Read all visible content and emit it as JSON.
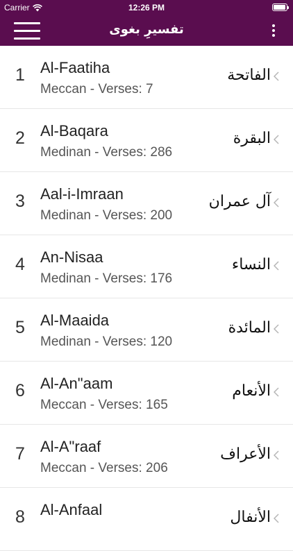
{
  "status_bar": {
    "carrier": "Carrier",
    "time": "12:26 PM",
    "battery_level": 0.95
  },
  "nav": {
    "title": "تفسیرِ بغوی",
    "menu_icon": "hamburger-menu-icon",
    "more_icon": "more-vertical-icon"
  },
  "colors": {
    "brand": "#5a0d4f",
    "divider": "#e6e6e6"
  },
  "surahs": [
    {
      "number": "1",
      "name": "Al-Faatiha",
      "subtitle": "Meccan - Verses: 7",
      "arabic": "الفاتحة"
    },
    {
      "number": "2",
      "name": "Al-Baqara",
      "subtitle": "Medinan - Verses: 286",
      "arabic": "البقرة"
    },
    {
      "number": "3",
      "name": "Aal-i-Imraan",
      "subtitle": "Medinan - Verses: 200",
      "arabic": "آل عمران"
    },
    {
      "number": "4",
      "name": "An-Nisaa",
      "subtitle": "Medinan - Verses: 176",
      "arabic": "النساء"
    },
    {
      "number": "5",
      "name": "Al-Maaida",
      "subtitle": "Medinan - Verses: 120",
      "arabic": "المائدة"
    },
    {
      "number": "6",
      "name": "Al-An\"aam",
      "subtitle": "Meccan - Verses: 165",
      "arabic": "الأنعام"
    },
    {
      "number": "7",
      "name": "Al-A\"raaf",
      "subtitle": "Meccan - Verses: 206",
      "arabic": "الأعراف"
    },
    {
      "number": "8",
      "name": "Al-Anfaal",
      "subtitle": "",
      "arabic": "الأنفال"
    }
  ]
}
